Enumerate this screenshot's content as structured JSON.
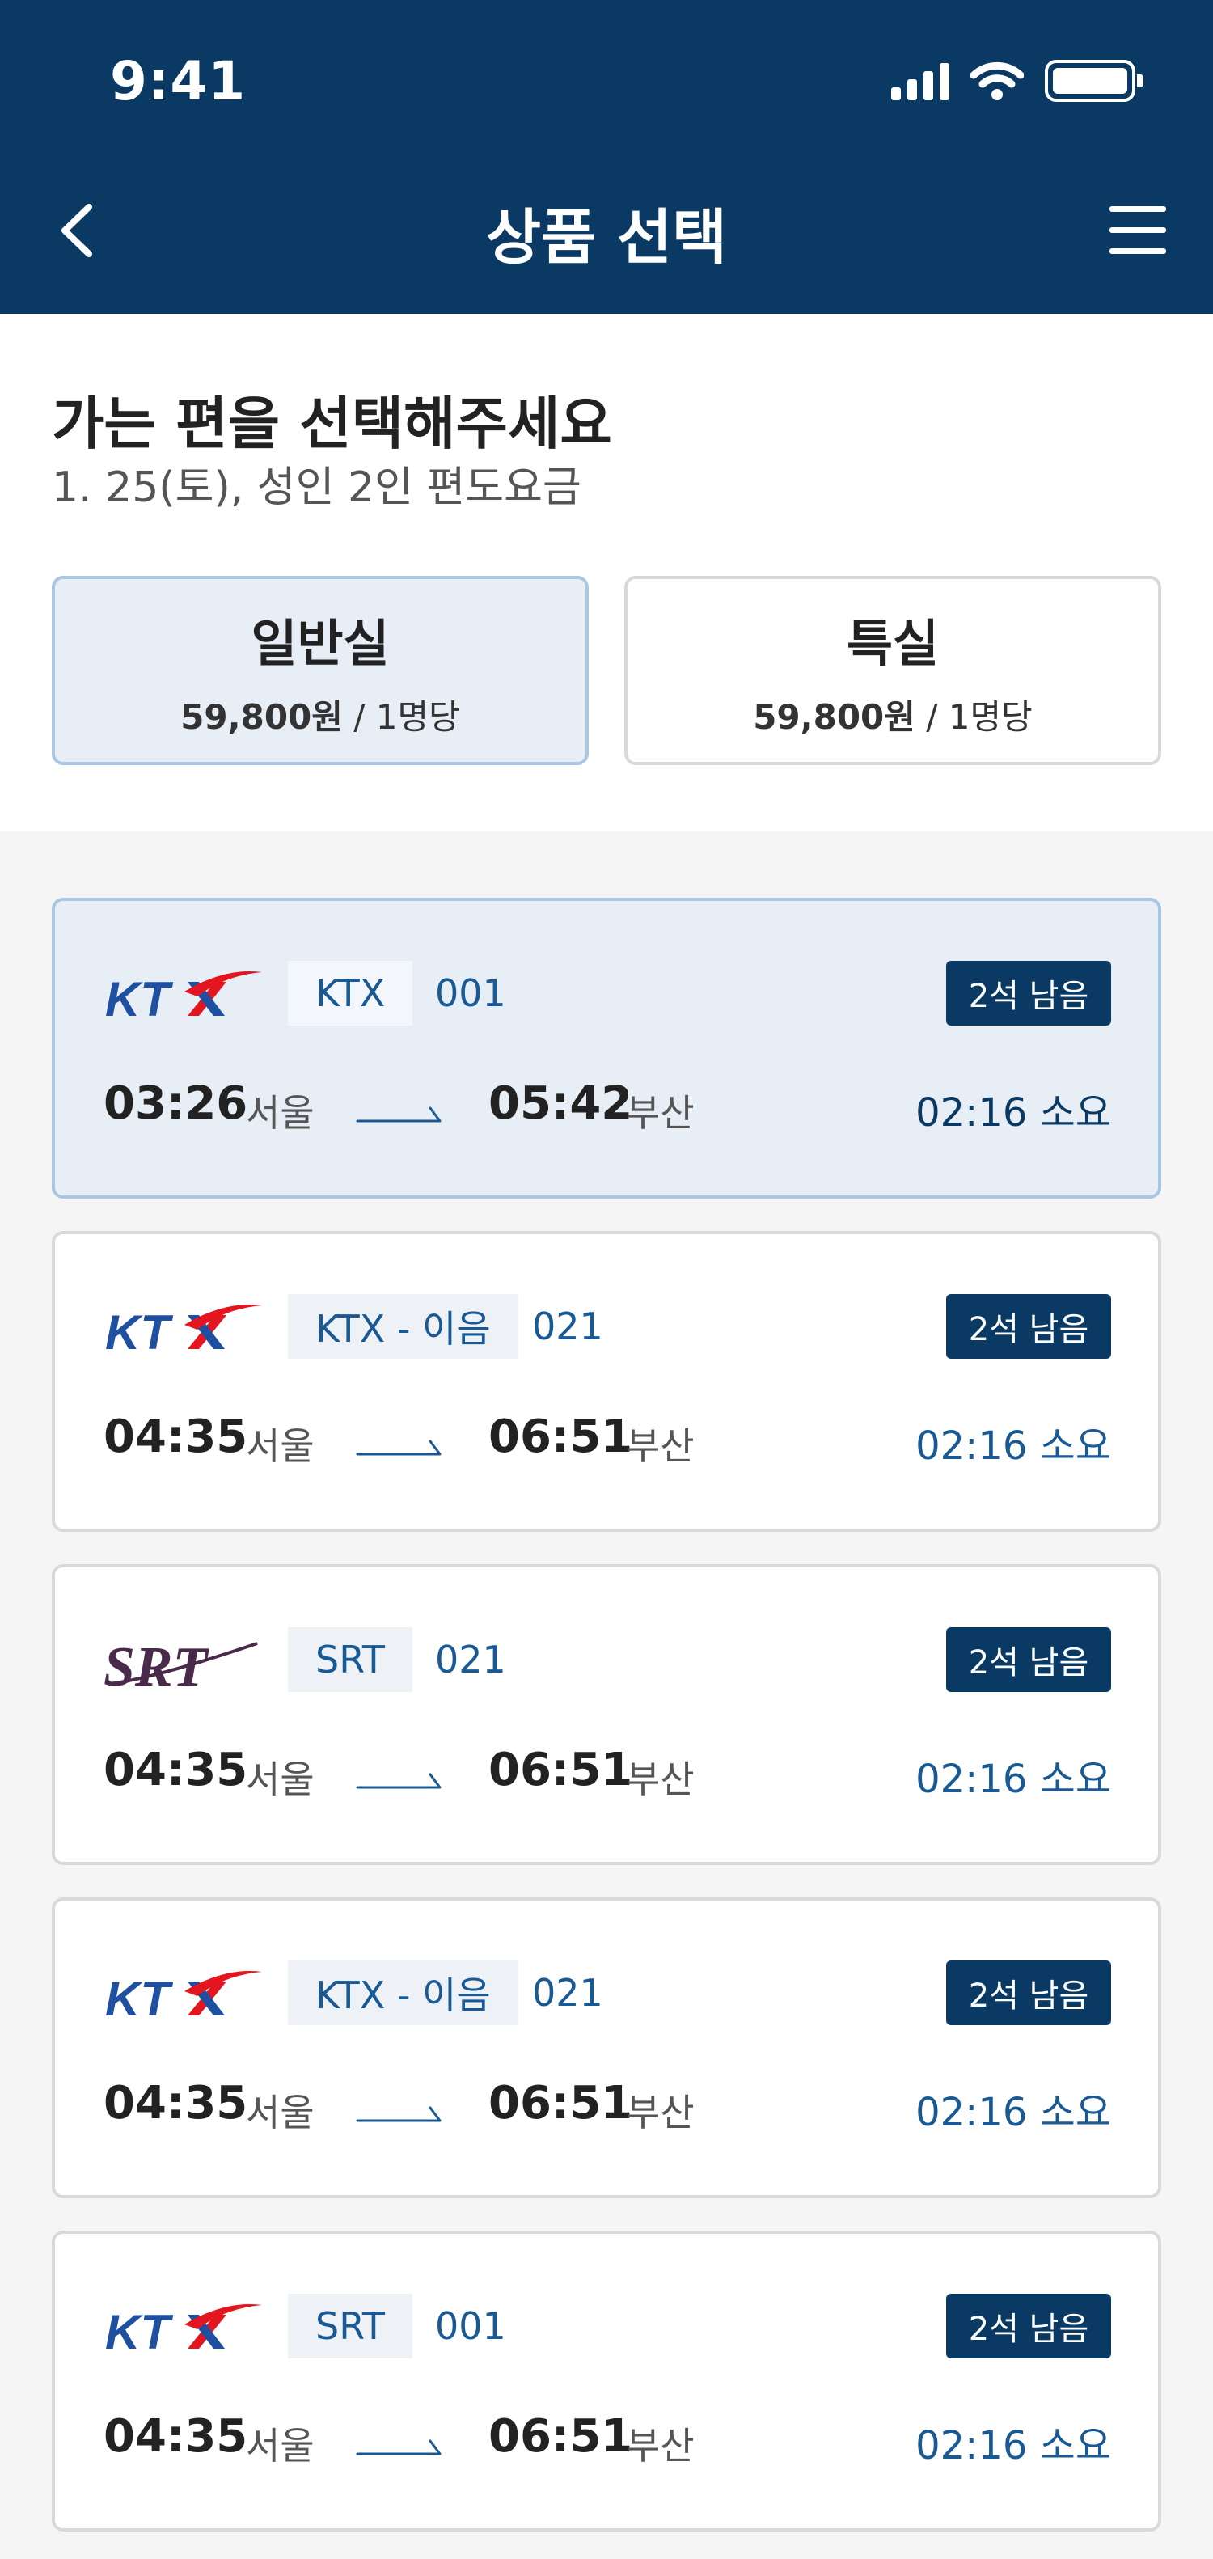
{
  "status": {
    "time": "9:41"
  },
  "nav": {
    "title": "상품 선택"
  },
  "intro": {
    "title": "가는 편을 선택해주세요",
    "subtitle": "1. 25(토), 성인 2인 편도요금"
  },
  "classes": [
    {
      "name": "일반실",
      "price": "59,800원",
      "unit": " / 1명당",
      "active": true
    },
    {
      "name": "특실",
      "price": "59,800원",
      "unit": " / 1명당",
      "active": false
    }
  ],
  "trains": [
    {
      "logo": "KTX",
      "type": "KTX",
      "number": "001",
      "seats": "2석 남음",
      "dep_time": "03:26",
      "dep_station": "서울",
      "arr_time": "05:42",
      "arr_station": "부산",
      "duration": "02:16 소요",
      "selected": true
    },
    {
      "logo": "KTX",
      "type": "KTX - 이음",
      "number": "021",
      "seats": "2석 남음",
      "dep_time": "04:35",
      "dep_station": "서울",
      "arr_time": "06:51",
      "arr_station": "부산",
      "duration": "02:16 소요",
      "selected": false
    },
    {
      "logo": "SRT",
      "type": "SRT",
      "number": "021",
      "seats": "2석 남음",
      "dep_time": "04:35",
      "dep_station": "서울",
      "arr_time": "06:51",
      "arr_station": "부산",
      "duration": "02:16 소요",
      "selected": false
    },
    {
      "logo": "KTX",
      "type": "KTX - 이음",
      "number": "021",
      "seats": "2석 남음",
      "dep_time": "04:35",
      "dep_station": "서울",
      "arr_time": "06:51",
      "arr_station": "부산",
      "duration": "02:16 소요",
      "selected": false
    },
    {
      "logo": "KTX",
      "type": "SRT",
      "number": "001",
      "seats": "2석 남음",
      "dep_time": "04:35",
      "dep_station": "서울",
      "arr_time": "06:51",
      "arr_station": "부산",
      "duration": "02:16 소요",
      "selected": false
    }
  ],
  "colors": {
    "header": "#0a3a64",
    "accent": "#1a5a94",
    "selected_bg": "#e7eef6",
    "ktx_red": "#e3151f",
    "srt_purple": "#4a2a4a"
  }
}
